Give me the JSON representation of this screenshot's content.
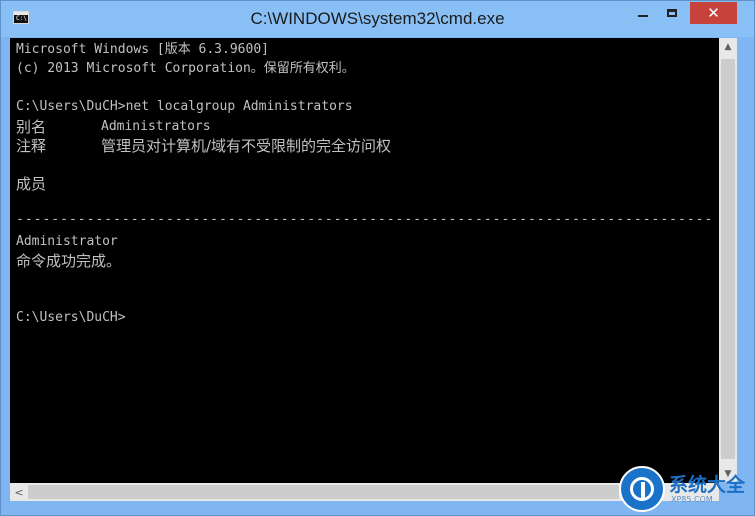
{
  "window": {
    "title": "C:\\WINDOWS\\system32\\cmd.exe",
    "icon": "cmd-app-icon",
    "icon_glyph": "C:\\",
    "buttons": {
      "minimize": "minimize-icon",
      "maximize": "maximize-icon",
      "close_glyph": "✕"
    }
  },
  "console": {
    "header_line1": "Microsoft Windows [版本 6.3.9600]",
    "header_line2": "(c) 2013 Microsoft Corporation。保留所有权利。",
    "command_line": "C:\\Users\\DuCH>net localgroup Administrators",
    "alias_label": "别名",
    "alias_value": "Administrators",
    "comment_label": "注释",
    "comment_value": "管理员对计算机/域有不受限制的完全访问权",
    "members_label": "成员",
    "separator": "-------------------------------------------------------------------------------",
    "member": "Administrator",
    "result": "命令成功完成。",
    "prompt": "C:\\Users\\DuCH>"
  },
  "scrollbars": {
    "up_arrow": "▲",
    "down_arrow": "▼",
    "left_arrow": "<",
    "right_arrow": ">"
  },
  "watermark": {
    "text": "系统大全",
    "url": "XP85.COM",
    "color": "#1c6fc4"
  },
  "colors": {
    "console_bg": "#000000",
    "console_fg": "#c0c0c0",
    "titlebar": "#88c0f6",
    "close_button": "#c7423b"
  }
}
